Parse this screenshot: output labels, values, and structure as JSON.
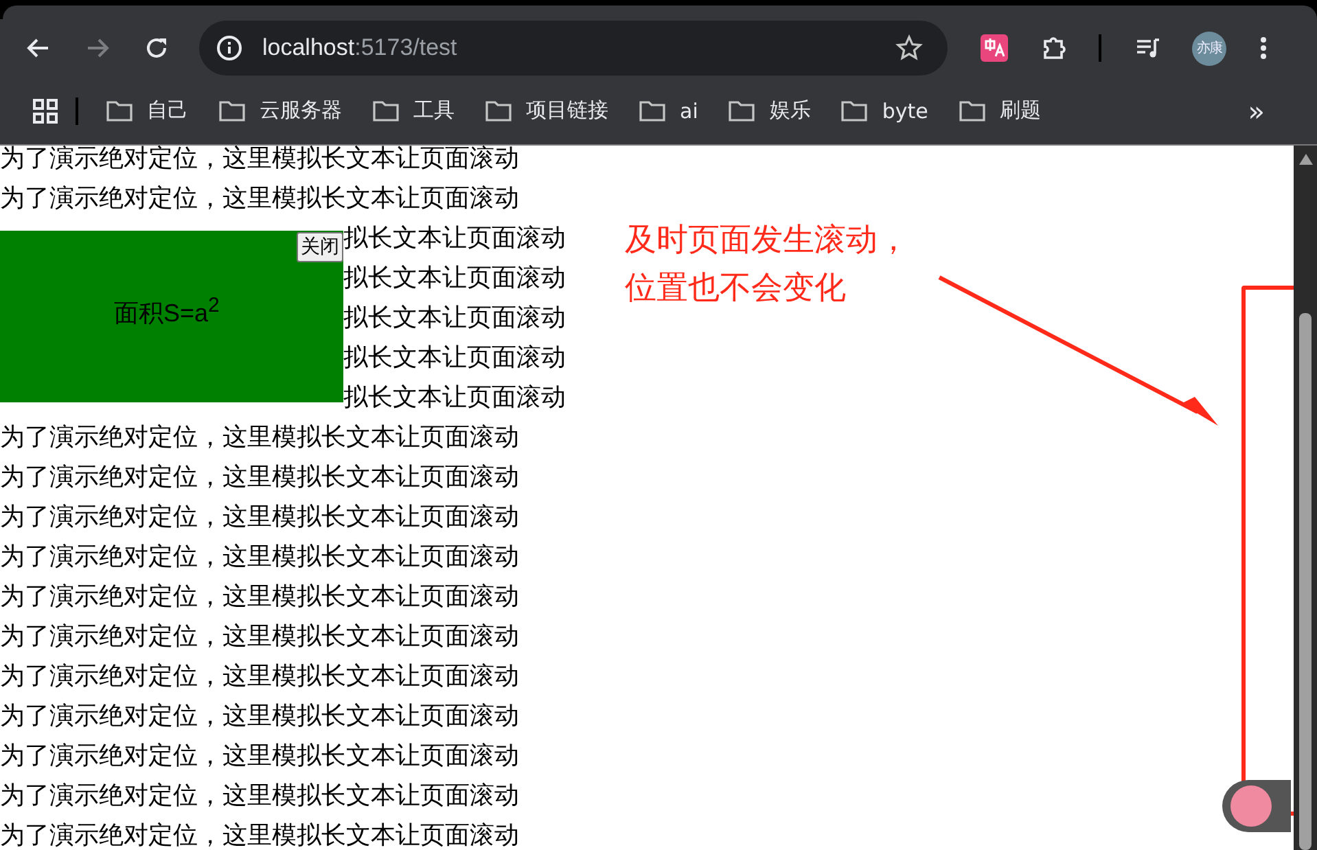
{
  "browser": {
    "url_host": "localhost",
    "url_rest": ":5173/test",
    "avatar": "亦康",
    "overflow": "»",
    "bookmarks": [
      "自己",
      "云服务器",
      "工具",
      "项目链接",
      "ai",
      "娱乐",
      "byte",
      "刷题"
    ]
  },
  "page": {
    "lines": [
      {
        "kind": "full",
        "text": "为了演示绝对定位，这里模拟长文本让页面滚动"
      },
      {
        "kind": "full",
        "text": "为了演示绝对定位，这里模拟长文本让页面滚动"
      },
      {
        "kind": "tail",
        "text": "拟长文本让页面滚动"
      },
      {
        "kind": "tail",
        "text": "拟长文本让页面滚动"
      },
      {
        "kind": "tail",
        "text": "拟长文本让页面滚动"
      },
      {
        "kind": "tail",
        "text": "拟长文本让页面滚动"
      },
      {
        "kind": "tail",
        "text": "拟长文本让页面滚动"
      },
      {
        "kind": "full",
        "text": "为了演示绝对定位，这里模拟长文本让页面滚动"
      },
      {
        "kind": "full",
        "text": "为了演示绝对定位，这里模拟长文本让页面滚动"
      },
      {
        "kind": "full",
        "text": "为了演示绝对定位，这里模拟长文本让页面滚动"
      },
      {
        "kind": "full",
        "text": "为了演示绝对定位，这里模拟长文本让页面滚动"
      },
      {
        "kind": "full",
        "text": "为了演示绝对定位，这里模拟长文本让页面滚动"
      },
      {
        "kind": "full",
        "text": "为了演示绝对定位，这里模拟长文本让页面滚动"
      },
      {
        "kind": "full",
        "text": "为了演示绝对定位，这里模拟长文本让页面滚动"
      },
      {
        "kind": "full",
        "text": "为了演示绝对定位，这里模拟长文本让页面滚动"
      },
      {
        "kind": "full",
        "text": "为了演示绝对定位，这里模拟长文本让页面滚动"
      },
      {
        "kind": "full",
        "text": "为了演示绝对定位，这里模拟长文本让页面滚动"
      },
      {
        "kind": "full",
        "text": "为了演示绝对定位，这里模拟长文本让页面滚动"
      }
    ],
    "popup": {
      "formula": "面积S=a$^{2}$",
      "close_button": "关闭"
    }
  },
  "annotation": {
    "lines": [
      "及时页面发生滚动，",
      "位置也不会变化"
    ]
  }
}
